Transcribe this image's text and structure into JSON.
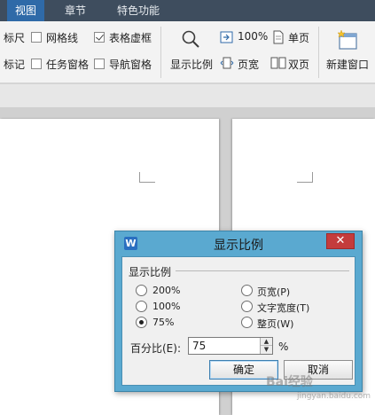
{
  "tabs": [
    {
      "label": "视图",
      "active": true
    },
    {
      "label": "章节",
      "active": false
    },
    {
      "label": "特色功能",
      "active": false
    }
  ],
  "ribbon": {
    "ruler": {
      "label": "标尺",
      "checked": false
    },
    "gridlines": {
      "label": "网格线",
      "checked": false
    },
    "table_gridlines": {
      "label": "表格虚框",
      "checked": true
    },
    "marks": {
      "label": "标记",
      "checked": false
    },
    "task_pane": {
      "label": "任务窗格",
      "checked": false
    },
    "nav_pane": {
      "label": "导航窗格",
      "checked": false
    },
    "zoom_label": "显示比例",
    "hundred_label": "100%",
    "page_width_label": "页宽",
    "single_page_label": "单页",
    "two_page_label": "双页",
    "new_window_label": "新建窗口"
  },
  "dialog": {
    "title": "显示比例",
    "close_label": "✕",
    "group_label": "显示比例",
    "options": [
      {
        "label": "200%",
        "selected": false
      },
      {
        "label": "100%",
        "selected": false
      },
      {
        "label": "75%",
        "selected": true
      },
      {
        "label": "页宽(P)",
        "selected": false
      },
      {
        "label": "文字宽度(T)",
        "selected": false
      },
      {
        "label": "整页(W)",
        "selected": false
      }
    ],
    "percent_label": "百分比(E):",
    "percent_value": "75",
    "percent_sign": "%",
    "ok_label": "确定",
    "cancel_label": "取消"
  },
  "watermark": {
    "text": "Bai经验",
    "sub": "jingyan.baidu.com"
  },
  "colors": {
    "tabbar": "#3e4d5e",
    "active_tab": "#2f6aa8",
    "dialog_frame": "#5aa9d0",
    "close": "#c43c3c"
  }
}
